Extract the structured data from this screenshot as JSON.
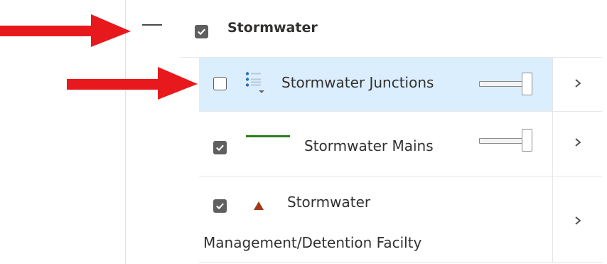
{
  "group": {
    "label": "Stormwater",
    "checked": true
  },
  "layers": [
    {
      "label": "Stormwater Junctions",
      "checked": false,
      "symbol": "point-list-icon",
      "opacity": 1.0,
      "highlighted": true
    },
    {
      "label": "Stormwater Mains",
      "checked": true,
      "symbol": "green-line-icon",
      "opacity": 1.0,
      "highlighted": false
    },
    {
      "label_line1": "Stormwater",
      "label_line2": "Management/Detention Facilty",
      "checked": true,
      "symbol": "brown-triangle-icon",
      "highlighted": false
    }
  ],
  "colors": {
    "highlight": "#dbeefd",
    "arrow": "#e8191c",
    "line_symbol": "#2e7d1f",
    "triangle_symbol": "#a0391a",
    "point_symbol": "#2f6fbe"
  }
}
